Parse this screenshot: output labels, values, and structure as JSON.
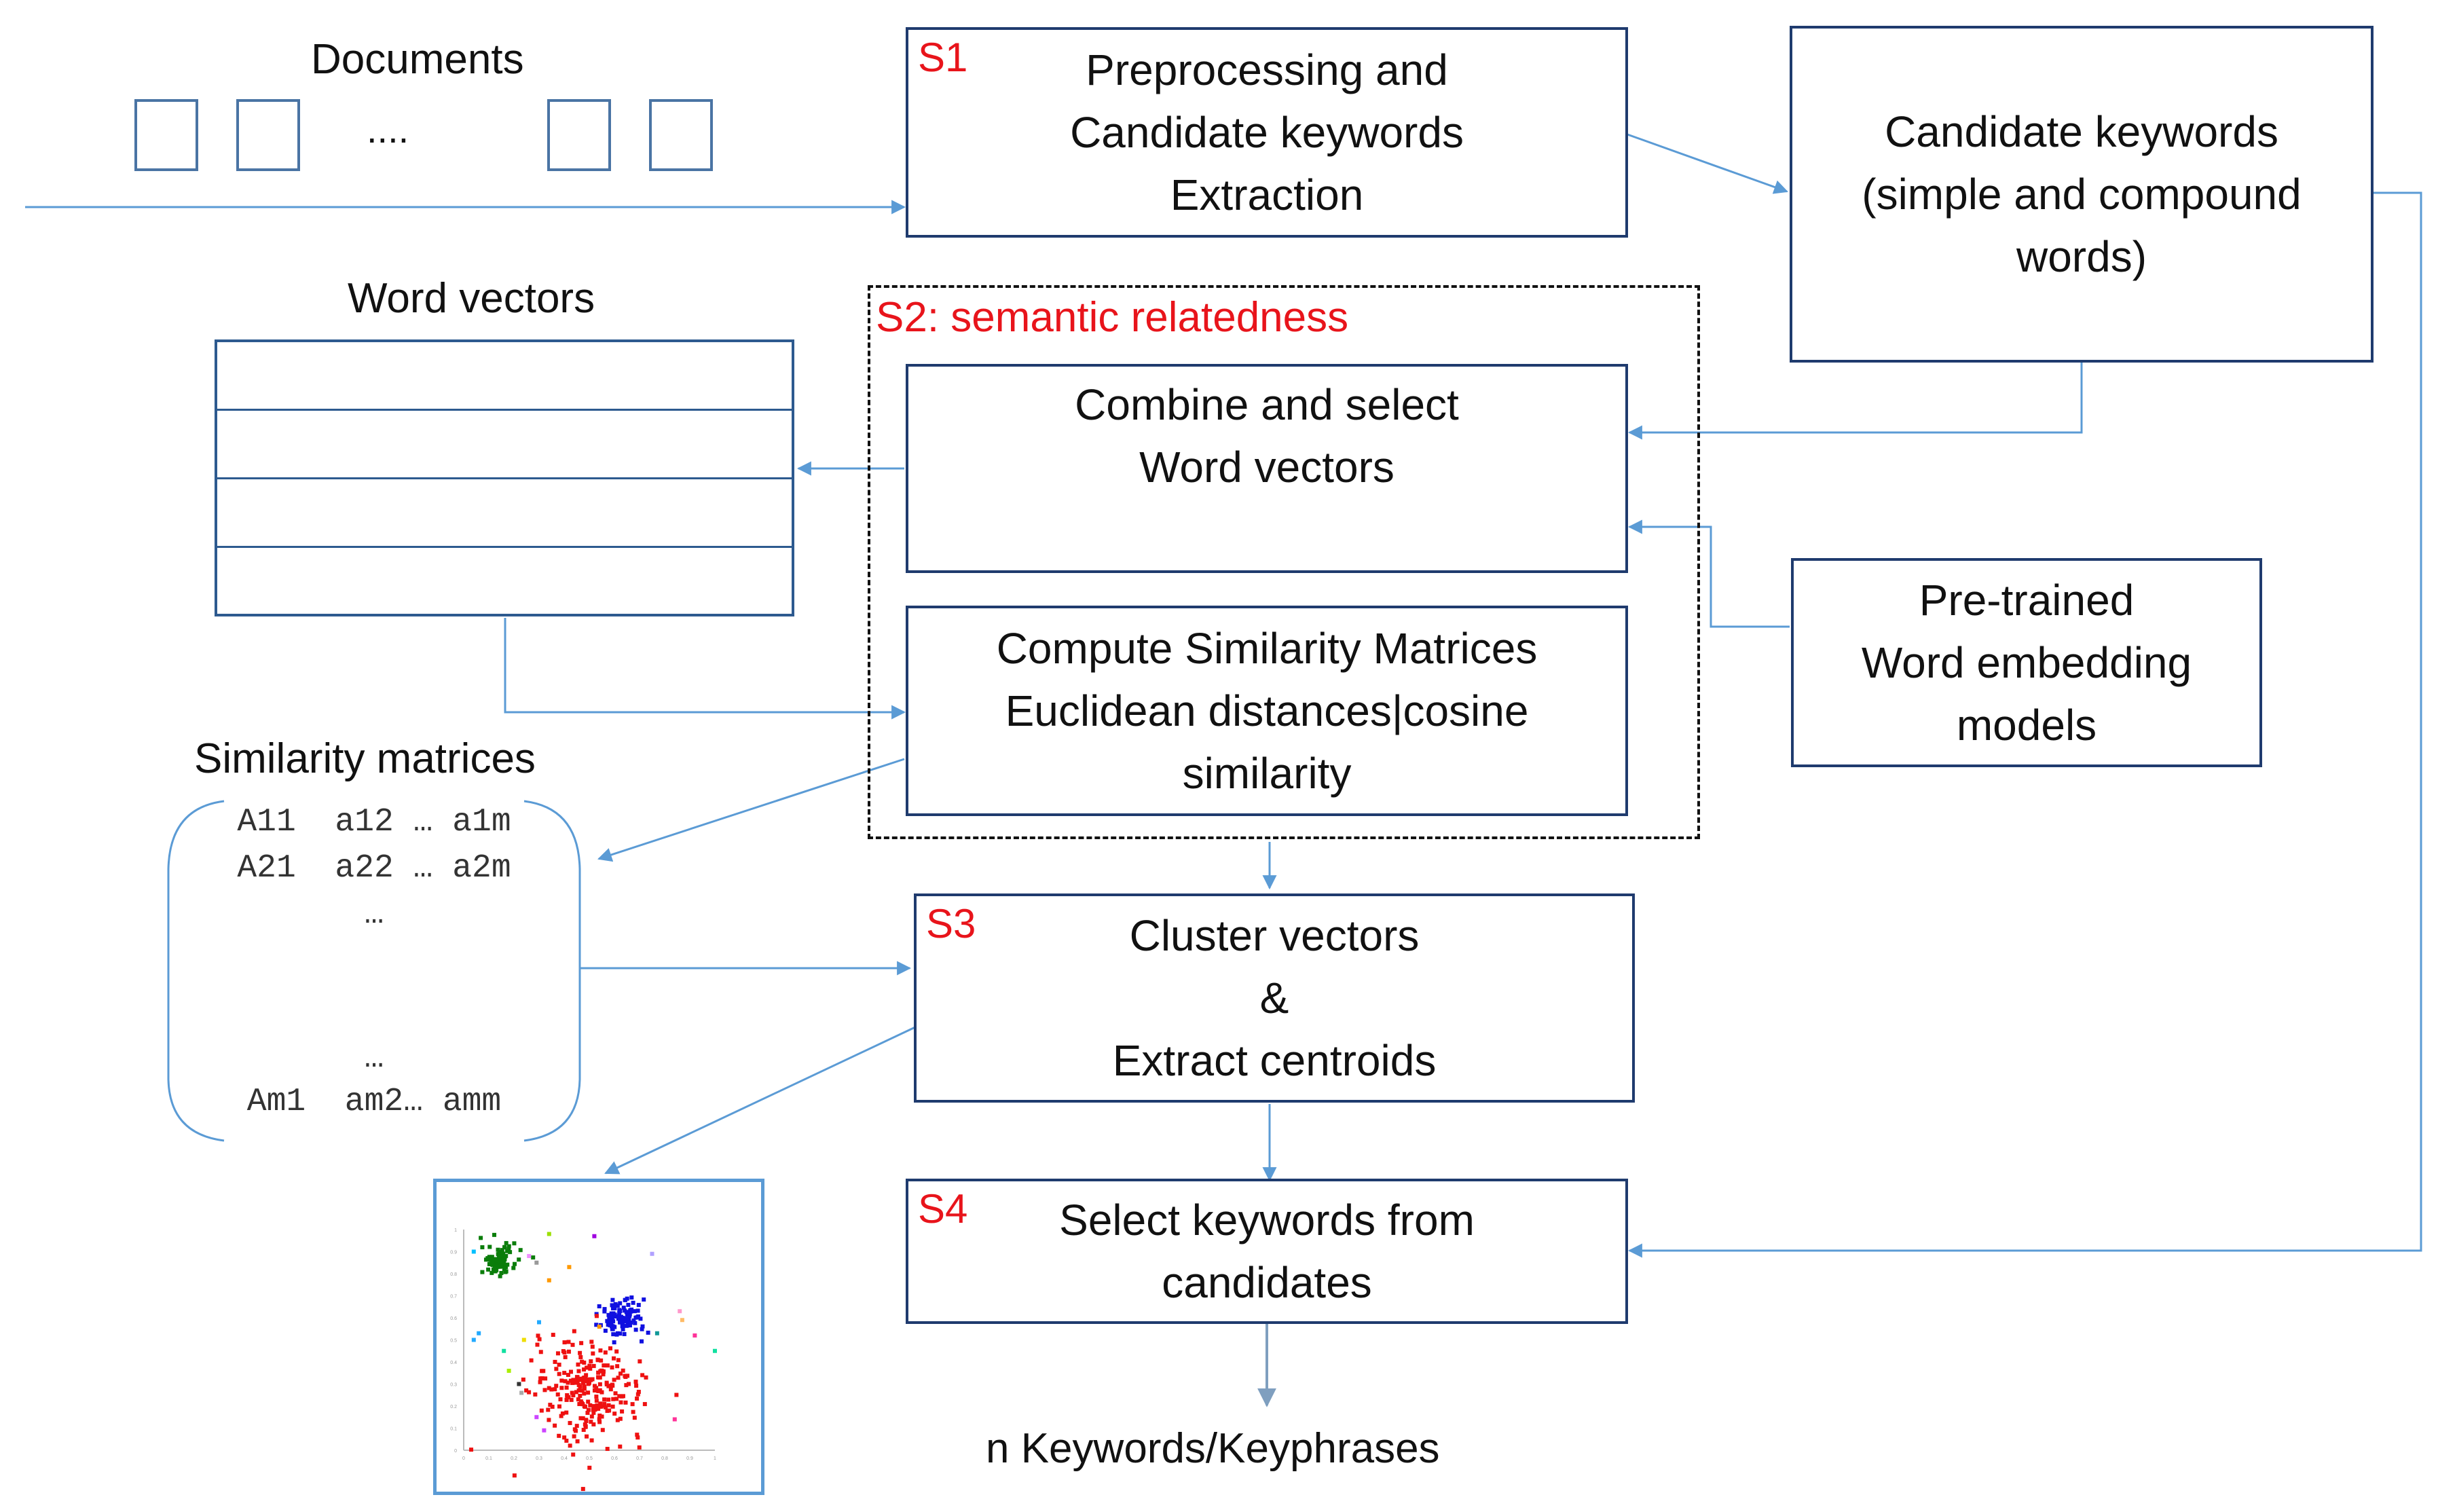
{
  "documents": {
    "label": "Documents",
    "ellipsis": "...."
  },
  "word_vectors": {
    "label": "Word vectors",
    "rows": 4
  },
  "similarity": {
    "label": "Similarity matrices",
    "rows": [
      "A11  a12 … a1m",
      "A21  a22 … a2m",
      "…",
      "…",
      "Am1  am2… amm"
    ]
  },
  "s1": {
    "tag": "S1",
    "lines": [
      "Preprocessing and",
      "Candidate keywords",
      "Extraction"
    ]
  },
  "candidates": {
    "lines": [
      "Candidate keywords",
      "(simple and compound",
      "words)"
    ]
  },
  "s2": {
    "title": "S2: semantic relatedness",
    "combine": {
      "lines": [
        "Combine and select",
        "Word vectors"
      ]
    },
    "compute": {
      "lines": [
        "Compute Similarity Matrices",
        "Euclidean distances|cosine",
        "similarity"
      ]
    }
  },
  "pretrained": {
    "lines": [
      "Pre-trained",
      "Word embedding",
      "models"
    ]
  },
  "s3": {
    "tag": "S3",
    "lines": [
      "Cluster vectors",
      "&",
      "Extract centroids"
    ]
  },
  "s4": {
    "tag": "S4",
    "lines": [
      "Select keywords from",
      "candidates"
    ]
  },
  "output": {
    "label": "n Keywords/Keyphrases"
  },
  "colors": {
    "box_border": "#1f3b6e",
    "arrow": "#5b9bd5",
    "step_tag": "#e8141b"
  },
  "chart_data": {
    "type": "scatter",
    "title": "",
    "xlabel": "",
    "ylabel": "",
    "xlim": [
      0,
      1
    ],
    "ylim": [
      0,
      1
    ],
    "x_ticks": [
      "0",
      "0.1",
      "0.2",
      "0.3",
      "0.4",
      "0.5",
      "0.6",
      "0.7",
      "0.8",
      "0.9",
      "1"
    ],
    "y_ticks": [
      "0",
      "0.1",
      "0.2",
      "0.3",
      "0.4",
      "0.5",
      "0.6",
      "0.7",
      "0.8",
      "0.9",
      "1"
    ],
    "series": [
      {
        "name": "cluster-green",
        "color": "#0a7d0a",
        "center": [
          0.14,
          0.86
        ],
        "spread": 0.07,
        "n": 90
      },
      {
        "name": "cluster-blue",
        "color": "#1010e0",
        "center": [
          0.63,
          0.6
        ],
        "spread": 0.09,
        "n": 110
      },
      {
        "name": "cluster-red",
        "color": "#ee1111",
        "center": [
          0.5,
          0.27
        ],
        "spread": 0.22,
        "n": 260
      },
      {
        "name": "outliers",
        "color": "mixed",
        "points": [
          [
            0.04,
            0.9,
            "#00c0ff"
          ],
          [
            0.34,
            0.98,
            "#9be000"
          ],
          [
            0.52,
            0.97,
            "#a000e0"
          ],
          [
            0.26,
            0.88,
            "#f090ff"
          ],
          [
            0.29,
            0.85,
            "#999999"
          ],
          [
            0.42,
            0.83,
            "#ff9900"
          ],
          [
            0.34,
            0.77,
            "#ff9900"
          ],
          [
            0.75,
            0.89,
            "#b0a0ff"
          ],
          [
            0.3,
            0.58,
            "#22aaff"
          ],
          [
            0.06,
            0.53,
            "#22aaff"
          ],
          [
            0.04,
            0.5,
            "#22aaff"
          ],
          [
            0.16,
            0.45,
            "#11e0a0"
          ],
          [
            0.24,
            0.5,
            "#eedd00"
          ],
          [
            0.18,
            0.36,
            "#aaee00"
          ],
          [
            0.54,
            0.56,
            "#ff9900"
          ],
          [
            0.77,
            0.53,
            "#119999"
          ],
          [
            0.86,
            0.63,
            "#ff99cc"
          ],
          [
            0.87,
            0.59,
            "#ffbb66"
          ],
          [
            0.92,
            0.52,
            "#ff3399"
          ],
          [
            1.0,
            0.45,
            "#11e0a0"
          ],
          [
            0.84,
            0.14,
            "#ff3399"
          ],
          [
            0.32,
            0.09,
            "#cc44ff"
          ],
          [
            0.29,
            0.15,
            "#cc44ff"
          ],
          [
            0.23,
            0.26,
            "#aaaaaa"
          ],
          [
            0.22,
            0.3,
            "#333333"
          ]
        ]
      }
    ]
  }
}
